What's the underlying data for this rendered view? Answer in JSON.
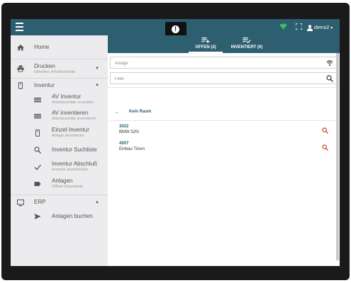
{
  "header": {
    "notification_badge": "!",
    "user_label": "demo2",
    "accent_color": "#2d5f70",
    "wifi_color": "#3dbd5f"
  },
  "sidebar": {
    "home": {
      "label": "Home",
      "icon": "home-icon"
    },
    "drucken": {
      "label": "Drucken",
      "sub": "Etiketten, Arbeitsvorräte",
      "icon": "printer-icon"
    },
    "inventur": {
      "label": "Inventur",
      "icon": "barcode-scanner-icon"
    },
    "inventur_items": [
      {
        "label": "AV Inventur",
        "sub": "Arbeitsvorräte verwalten",
        "icon": "list-icon"
      },
      {
        "label": "AV inventieren",
        "sub": "Arbeitsvorräte inventieren",
        "icon": "list-icon"
      },
      {
        "label": "Einzel Inventur",
        "sub": "Anlage inventieren",
        "icon": "barcode-scanner-icon"
      },
      {
        "label": "Inventur Suchliste",
        "sub": "",
        "icon": "search-icon"
      },
      {
        "label": "Inventur Abschluß",
        "sub": "Inventur abschließen",
        "icon": "check-icon"
      },
      {
        "label": "Anlagen",
        "sub": "Offline Datenbank",
        "icon": "tag-icon"
      }
    ],
    "erp": {
      "label": "ERP",
      "icon": "monitor-icon"
    },
    "erp_items": [
      {
        "label": "Anlagen buchen",
        "sub": "",
        "icon": "send-icon"
      }
    ]
  },
  "tabs": [
    {
      "label": "OFFEN (2)",
      "icon": "playlist-add-icon",
      "active": true
    },
    {
      "label": "INVENTIERT (0)",
      "icon": "playlist-check-icon",
      "active": false
    }
  ],
  "fields": {
    "anlage_placeholder": "Anlage",
    "filter_placeholder": "Filter"
  },
  "room": {
    "label": "Kein Raum"
  },
  "assets": [
    {
      "number": "3022",
      "name": "BMW 520i"
    },
    {
      "number": "4007",
      "name": "Einbau Türen"
    }
  ]
}
